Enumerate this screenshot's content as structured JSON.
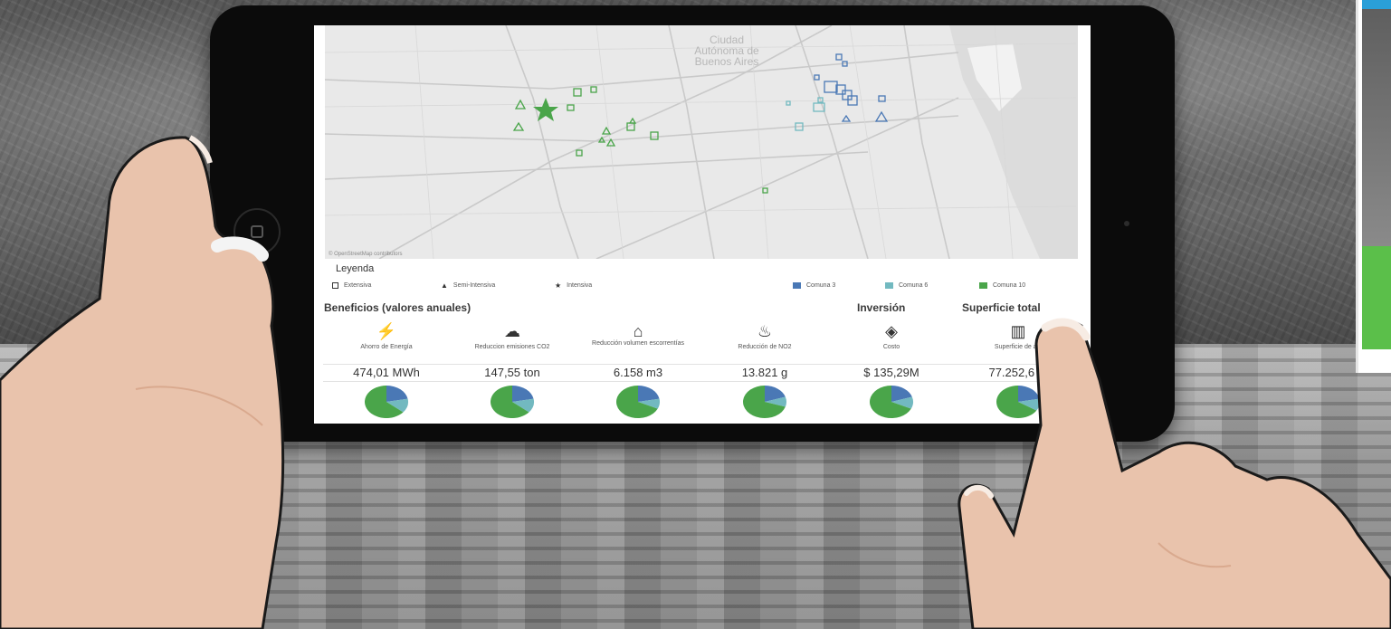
{
  "map": {
    "city_label": "Ciudad Autónoma de Buenos Aires",
    "credit": "© OpenStreetMap contributors"
  },
  "legend": {
    "title": "Leyenda",
    "types": [
      "Extensiva",
      "Semi-Intensiva",
      "Intensiva"
    ],
    "comunas": [
      {
        "label": "Comuna 3",
        "color": "#4a78b5"
      },
      {
        "label": "Comuna 6",
        "color": "#72b9c0"
      },
      {
        "label": "Comuna 10",
        "color": "#4aa54a"
      }
    ]
  },
  "sections": {
    "beneficios": "Beneficios (valores anuales)",
    "inversion": "Inversión",
    "superficie": "Superficie total"
  },
  "metrics": [
    {
      "label": "Ahorro de Energía",
      "value": "474,01 MWh",
      "icon": "energy-icon"
    },
    {
      "label": "Reduccion emisiones CO2",
      "value": "147,55 ton",
      "icon": "co2-cloud-icon"
    },
    {
      "label": "Reducción volumen escorrentías",
      "value": "6.158 m3",
      "icon": "house-water-icon"
    },
    {
      "label": "Reducción de NO2",
      "value": "13.821 g",
      "icon": "factory-icon"
    },
    {
      "label": "Costo",
      "value": "$ 135,29M",
      "icon": "money-icon"
    },
    {
      "label": "Superficie de act",
      "value": "77.252,6 m",
      "icon": "building-icon"
    }
  ],
  "pie_colors": {
    "comuna3": "#4a78b5",
    "comuna6": "#72b9c0",
    "comuna10": "#4aa54a"
  },
  "pie_shares": [
    {
      "comuna3": 0.22,
      "comuna6": 0.14,
      "comuna10": 0.64
    },
    {
      "comuna3": 0.22,
      "comuna6": 0.14,
      "comuna10": 0.64
    },
    {
      "comuna3": 0.22,
      "comuna6": 0.1,
      "comuna10": 0.68
    },
    {
      "comuna3": 0.2,
      "comuna6": 0.1,
      "comuna10": 0.7
    },
    {
      "comuna3": 0.2,
      "comuna6": 0.12,
      "comuna10": 0.68
    },
    {
      "comuna3": 0.22,
      "comuna6": 0.12,
      "comuna10": 0.66
    }
  ]
}
